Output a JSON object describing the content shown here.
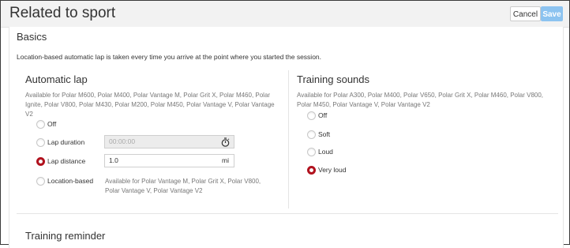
{
  "header": {
    "title": "Related to sport",
    "cancel_label": "Cancel",
    "save_label": "Save"
  },
  "basics": {
    "title": "Basics",
    "info": "Location-based automatic lap is taken every time you arrive at the point where you started the session."
  },
  "automatic_lap": {
    "title": "Automatic lap",
    "availability": "Available for Polar M600, Polar M400, Polar Vantage M, Polar Grit X, Polar M460, Polar Ignite, Polar V800, Polar M430, Polar M200, Polar M450, Polar Vantage V, Polar Vantage V2",
    "options": [
      {
        "label": "Off",
        "selected": false
      },
      {
        "label": "Lap duration",
        "selected": false
      },
      {
        "label": "Lap distance",
        "selected": true
      },
      {
        "label": "Location-based",
        "selected": false
      }
    ],
    "lap_duration_value": "00:00:00",
    "lap_distance_value": "1.0",
    "lap_distance_unit": "mi",
    "location_note": "Available for Polar Vantage M, Polar Grit X, Polar V800, Polar Vantage V, Polar Vantage V2",
    "icons": {
      "duration_field": "stopwatch-icon"
    }
  },
  "training_sounds": {
    "title": "Training sounds",
    "availability": "Available for Polar A300, Polar M400, Polar V650, Polar Grit X, Polar M460, Polar V800, Polar M450, Polar Vantage V, Polar Vantage V2",
    "options": [
      {
        "label": "Off",
        "selected": false
      },
      {
        "label": "Soft",
        "selected": false
      },
      {
        "label": "Loud",
        "selected": false
      },
      {
        "label": "Very loud",
        "selected": true
      }
    ]
  },
  "training_reminder": {
    "title": "Training reminder"
  },
  "colors": {
    "accent_selected": "#b1121e",
    "save_button": "#8cc3f0"
  }
}
